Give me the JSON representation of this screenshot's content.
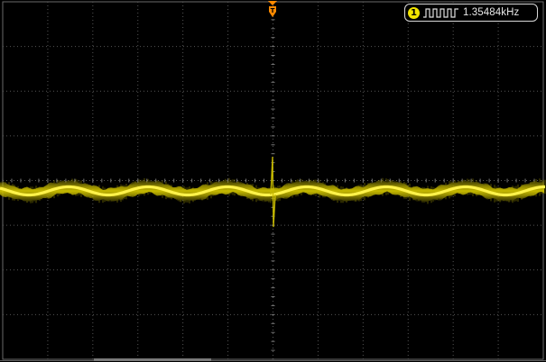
{
  "frequency_readout": {
    "channel": "1",
    "value": "1.35484kHz",
    "channel_color": "#f2e500",
    "waveform_icon": "square-pulse-icon"
  },
  "trigger_marker": {
    "icon": "trigger-position-marker-icon",
    "color": "#ff8a00"
  },
  "display": {
    "background_color": "#000000",
    "grid_color": "#555555",
    "trace_color": "#f2e500",
    "divisions_horizontal": 12,
    "divisions_vertical": 8
  }
}
